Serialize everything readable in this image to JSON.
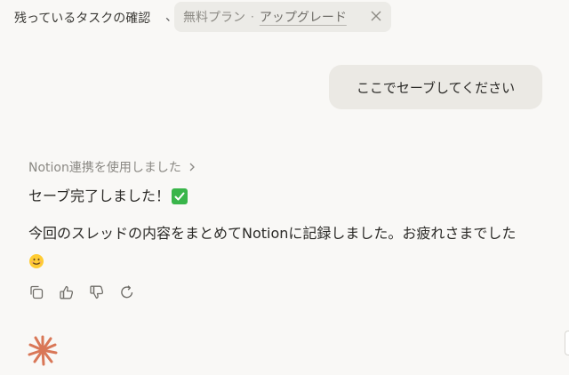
{
  "header": {
    "title": "残っているタスクの確認",
    "separator": "、",
    "plan_label": "無料プラン",
    "plan_dot": "·",
    "upgrade_label": "アップグレード",
    "close_icon": "close-icon"
  },
  "user_message": {
    "text": "ここでセーブしてください"
  },
  "assistant": {
    "tool_label": "Notion連携を使用しました",
    "tool_icon": "chevron-right-icon",
    "line1": "セーブ完了しました！",
    "line1_emoji": "check-mark-button-icon",
    "line2": "今回のスレッドの内容をまとめてNotionに記録しました。お疲れさまでした",
    "line2_emoji": "smiling-face-icon"
  },
  "actions": [
    {
      "name": "copy",
      "icon": "copy-icon"
    },
    {
      "name": "thumbs-up",
      "icon": "thumbs-up-icon"
    },
    {
      "name": "thumbs-down",
      "icon": "thumbs-down-icon"
    },
    {
      "name": "retry",
      "icon": "retry-icon"
    }
  ],
  "colors": {
    "background": "#f9f8f6",
    "user_bubble": "#ebe9e4",
    "brand_spark": "#d97757",
    "check_green": "#39b54a"
  }
}
